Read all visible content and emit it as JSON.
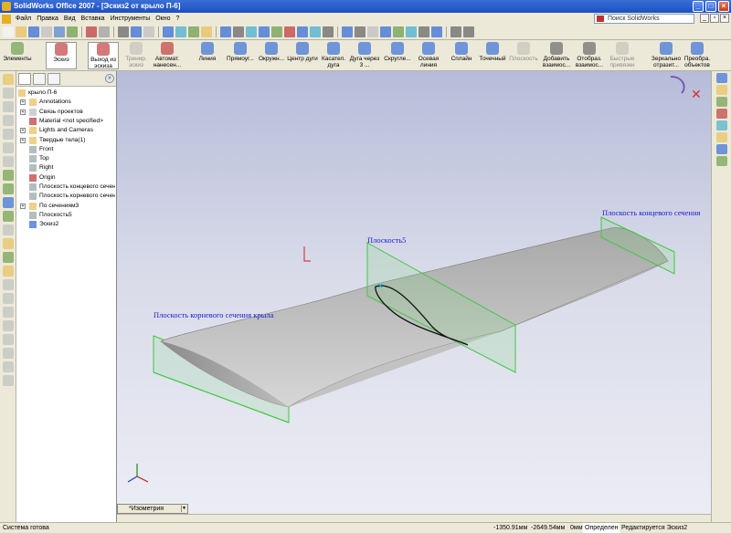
{
  "window": {
    "title": "SolidWorks Office 2007 - [Эскиз2 от крыло П-6]"
  },
  "menu": [
    "Файл",
    "Правка",
    "Вид",
    "Вставка",
    "Инструменты",
    "Окно",
    "?"
  ],
  "search": {
    "placeholder": "Поиск SolidWorks"
  },
  "commands": [
    {
      "label": "Элементы",
      "gray": false
    },
    {
      "label": "Эскиз",
      "gray": false
    },
    {
      "label": "Выход из эскиза",
      "gray": false
    },
    {
      "label": "Тренир. эскиз",
      "gray": true
    },
    {
      "label": "Автомат. нанесен...",
      "gray": false
    },
    {
      "label": "Линия",
      "gray": false
    },
    {
      "label": "Прямоуг...",
      "gray": false
    },
    {
      "label": "Окружн...",
      "gray": false
    },
    {
      "label": "Центр дуги",
      "gray": false
    },
    {
      "label": "Касател. дуга",
      "gray": false
    },
    {
      "label": "Дуга через 3 ...",
      "gray": false
    },
    {
      "label": "Скругле...",
      "gray": false
    },
    {
      "label": "Осевая линия",
      "gray": false
    },
    {
      "label": "Сплайн",
      "gray": false
    },
    {
      "label": "Точечный",
      "gray": false
    },
    {
      "label": "Плоскость",
      "gray": true
    },
    {
      "label": "Добавить взаимос...",
      "gray": false
    },
    {
      "label": "Отобраз. взаимос...",
      "gray": false
    },
    {
      "label": "Быстрые привязки",
      "gray": true
    },
    {
      "label": "Зеркально отразит...",
      "gray": false
    },
    {
      "label": "Преобра. объектов",
      "gray": false
    }
  ],
  "tree": {
    "items": [
      {
        "label": "крыло П-6",
        "indent": 0,
        "exp": "",
        "icon": "part-icon"
      },
      {
        "label": "Annotations",
        "indent": 1,
        "exp": "+",
        "icon": "annotations-icon"
      },
      {
        "label": "Связь проектов",
        "indent": 1,
        "exp": "+",
        "icon": "link-icon"
      },
      {
        "label": "Material <not specified>",
        "indent": 1,
        "exp": "",
        "icon": "material-icon"
      },
      {
        "label": "Lights and Cameras",
        "indent": 1,
        "exp": "+",
        "icon": "lights-icon"
      },
      {
        "label": "Твердые тела(1)",
        "indent": 1,
        "exp": "+",
        "icon": "solid-bodies-icon"
      },
      {
        "label": "Front",
        "indent": 1,
        "exp": "",
        "icon": "plane-icon"
      },
      {
        "label": "Top",
        "indent": 1,
        "exp": "",
        "icon": "plane-icon"
      },
      {
        "label": "Right",
        "indent": 1,
        "exp": "",
        "icon": "plane-icon"
      },
      {
        "label": "Origin",
        "indent": 1,
        "exp": "",
        "icon": "origin-icon"
      },
      {
        "label": "Плоскость концевого сечения",
        "indent": 1,
        "exp": "",
        "icon": "plane-icon"
      },
      {
        "label": "Плоскость корневого сечения",
        "indent": 1,
        "exp": "",
        "icon": "plane-icon"
      },
      {
        "label": "По сечениям3",
        "indent": 1,
        "exp": "+",
        "icon": "loft-icon"
      },
      {
        "label": "Плоскость5",
        "indent": 1,
        "exp": "",
        "icon": "plane-icon"
      },
      {
        "label": "Эскиз2",
        "indent": 1,
        "exp": "",
        "icon": "sketch-icon"
      }
    ]
  },
  "viewport": {
    "labels": {
      "tip": "Плоскость концевого сечения",
      "mid": "Плоскость5",
      "root": "Плоскость корневого сечения крыла"
    },
    "view_orientation": "*Изометрия"
  },
  "status": {
    "left": "Система готова",
    "x": "-1350.91мм",
    "y": "-2649.54мм",
    "z": "0мм",
    "state": "Определен",
    "mode": "Редактируется Эскиз2"
  }
}
